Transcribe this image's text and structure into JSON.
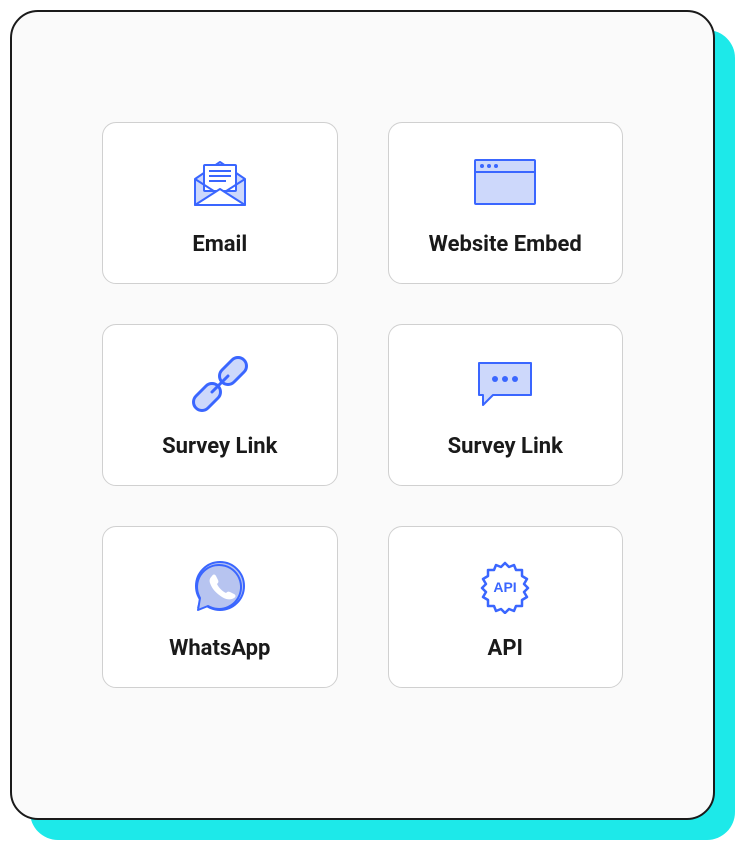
{
  "colors": {
    "accent_bg": "#1de9e9",
    "icon_stroke": "#3a66ff",
    "icon_fill": "#cdd8fb",
    "card_border": "#d0d0d0"
  },
  "options": [
    {
      "id": "email",
      "label": "Email",
      "icon": "email-icon"
    },
    {
      "id": "website-embed",
      "label": "Website Embed",
      "icon": "browser-icon"
    },
    {
      "id": "survey-link-1",
      "label": "Survey Link",
      "icon": "link-icon"
    },
    {
      "id": "survey-link-2",
      "label": "Survey Link",
      "icon": "chat-icon"
    },
    {
      "id": "whatsapp",
      "label": "WhatsApp",
      "icon": "whatsapp-icon"
    },
    {
      "id": "api",
      "label": "API",
      "icon": "api-gear-icon"
    }
  ]
}
